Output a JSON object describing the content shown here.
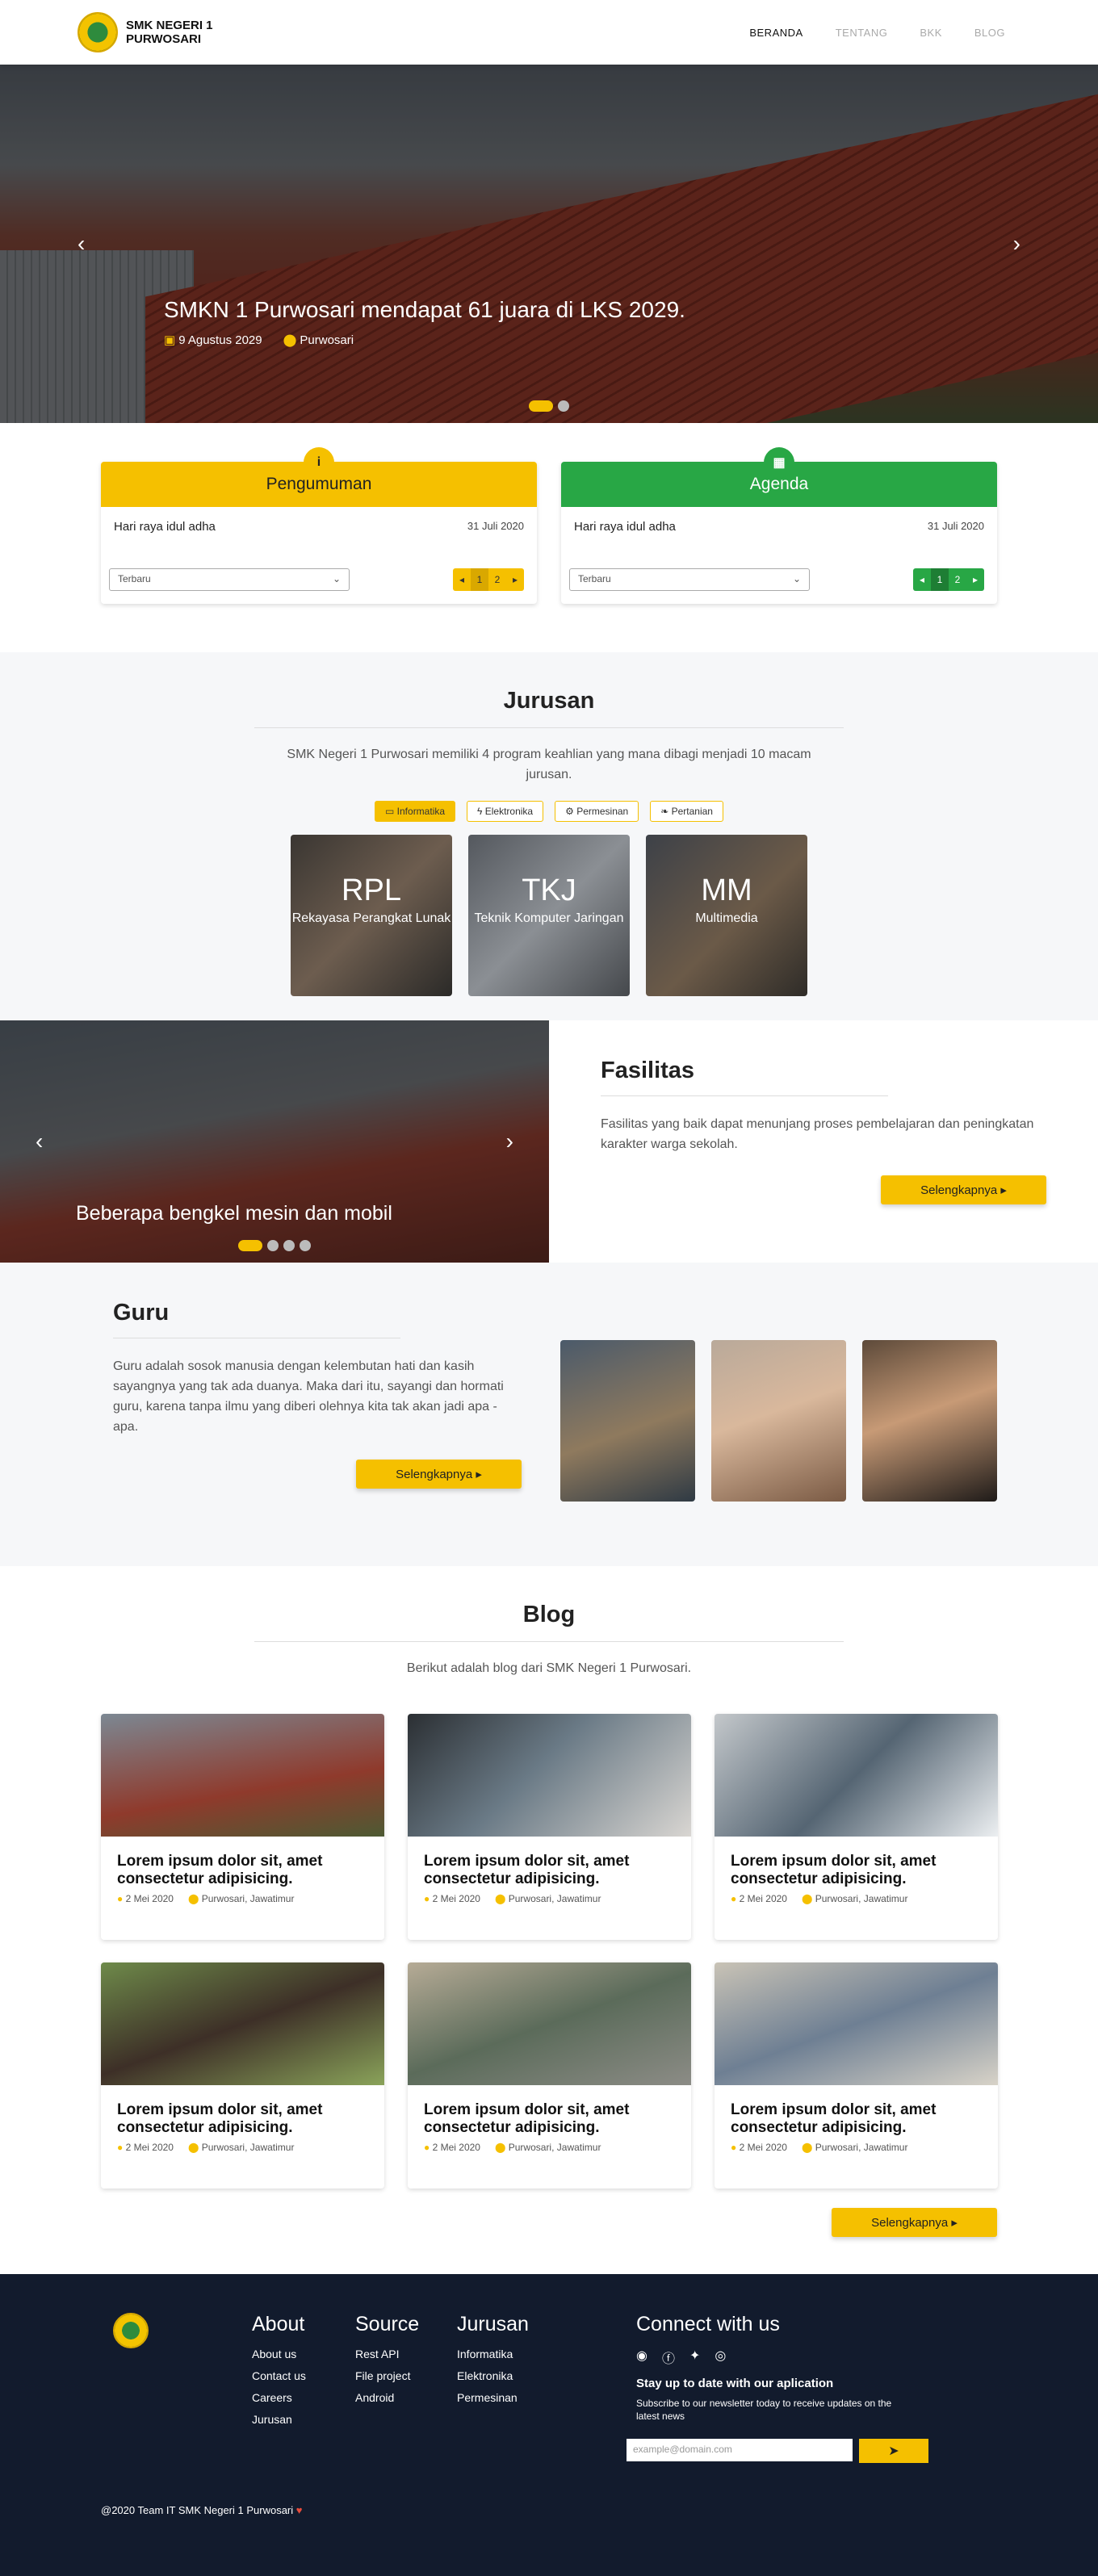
{
  "nav": {
    "brand": "SMK NEGERI 1\nPURWOSARI",
    "items": [
      "BERANDA",
      "TENTANG",
      "BKK",
      "BLOG"
    ]
  },
  "hero": {
    "title": "SMKN 1 Purwosari mendapat 61 juara di LKS 2029.",
    "date": "9 Agustus 2029",
    "place": "Purwosari",
    "prev": "‹",
    "next": "›"
  },
  "pengumuman": {
    "title": "Pengumuman",
    "icon": "i",
    "item": "Hari raya idul adha",
    "date": "31 Juli 2020",
    "select": "Terbaru",
    "pages": [
      "1",
      "2"
    ]
  },
  "agenda": {
    "title": "Agenda",
    "icon": "▦",
    "item": "Hari raya idul adha",
    "date": "31 Juli 2020",
    "select": "Terbaru",
    "pages": [
      "1",
      "2"
    ]
  },
  "jurusan": {
    "title": "Jurusan",
    "lead": "SMK Negeri 1 Purwosari memiliki 4 program keahlian yang mana dibagi menjadi 10 macam jurusan.",
    "tabs": [
      "Informatika",
      "Elektronika",
      "Permesinan",
      "Pertanian"
    ],
    "majors": [
      {
        "ab": "RPL",
        "name": "Rekayasa Perangkat Lunak"
      },
      {
        "ab": "TKJ",
        "name": "Teknik Komputer Jaringan"
      },
      {
        "ab": "MM",
        "name": "Multimedia"
      }
    ]
  },
  "fasilitas": {
    "title": "Fasilitas",
    "text": "Fasilitas yang baik dapat menunjang proses pembelajaran dan peningkatan karakter warga sekolah.",
    "caption": "Beberapa bengkel mesin dan mobil",
    "button": "Selengkapnya ▸"
  },
  "guru": {
    "title": "Guru",
    "text": "Guru adalah sosok manusia dengan kelembutan hati dan kasih sayangnya yang tak ada duanya. Maka dari itu, sayangi dan hormati guru, karena tanpa ilmu yang diberi olehnya kita tak akan jadi apa - apa.",
    "button": "Selengkapnya ▸"
  },
  "blog": {
    "title": "Blog",
    "lead": "Berikut adalah blog dari SMK Negeri 1 Purwosari.",
    "button": "Selengkapnya ▸",
    "posts": [
      {
        "title": "Lorem ipsum dolor sit, amet consectetur adipisicing.",
        "date": "2 Mei 2020",
        "place": "Purwosari, Jawatimur"
      },
      {
        "title": "Lorem ipsum dolor sit, amet consectetur adipisicing.",
        "date": "2 Mei 2020",
        "place": "Purwosari, Jawatimur"
      },
      {
        "title": "Lorem ipsum dolor sit, amet consectetur adipisicing.",
        "date": "2 Mei 2020",
        "place": "Purwosari, Jawatimur"
      },
      {
        "title": "Lorem ipsum dolor sit, amet consectetur adipisicing.",
        "date": "2 Mei 2020",
        "place": "Purwosari, Jawatimur"
      },
      {
        "title": "Lorem ipsum dolor sit, amet consectetur adipisicing.",
        "date": "2 Mei 2020",
        "place": "Purwosari, Jawatimur"
      },
      {
        "title": "Lorem ipsum dolor sit, amet consectetur adipisicing.",
        "date": "2 Mei 2020",
        "place": "Purwosari, Jawatimur"
      }
    ]
  },
  "footer": {
    "about": {
      "title": "About",
      "links": [
        "About us",
        "Contact us",
        "Careers",
        "Jurusan"
      ]
    },
    "source": {
      "title": "Source",
      "links": [
        "Rest API",
        "File project",
        "Android"
      ]
    },
    "jurusan": {
      "title": "Jurusan",
      "links": [
        "Informatika",
        "Elektronika",
        "Permesinan"
      ]
    },
    "connect": {
      "title": "Connect with us",
      "headline": "Stay up to date with our aplication",
      "sub": "Subscribe to our newsletter today to receive updates on the latest news",
      "placeholder": "example@domain.com"
    },
    "copy": "@2020 Team IT SMK Negeri 1 Purwosari"
  },
  "colors": {
    "yellow": "#f5c000",
    "green": "#28a745",
    "footer": "#121b2d"
  }
}
